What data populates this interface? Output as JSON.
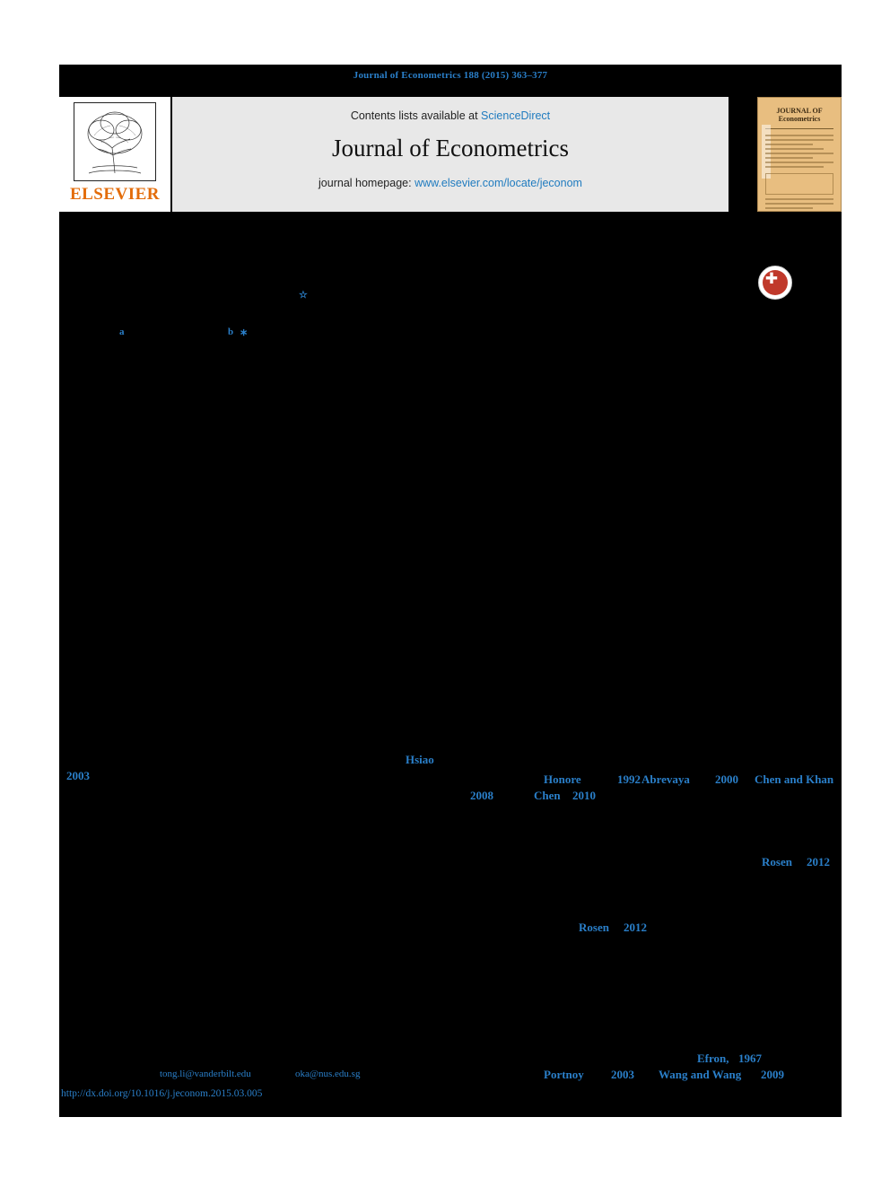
{
  "running_head": "Journal of Econometrics 188 (2015) 363–377",
  "masthead": {
    "publisher_name": "ELSEVIER",
    "contents_prefix": "Contents lists available at",
    "contents_link": "ScienceDirect",
    "journal_title": "Journal of Econometrics",
    "homepage_prefix": "journal homepage:",
    "homepage_link": "www.elsevier.com/locate/jeconom",
    "cover_title": "JOURNAL OF Econometrics"
  },
  "crossmark": {
    "label": "CrossMark",
    "glyph": "✚",
    "color": "#c0392b"
  },
  "title_marks": {
    "footnote_star": "☆",
    "affil_a": "a",
    "affil_b": "b",
    "corresponding_star": "∗"
  },
  "citations": [
    {
      "text": "Hsiao"
    },
    {
      "text": "2003"
    },
    {
      "text": "Honore"
    },
    {
      "text": "1992"
    },
    {
      "text": "Abrevaya"
    },
    {
      "text": "2000"
    },
    {
      "text": "Chen and Khan"
    },
    {
      "text": "2008"
    },
    {
      "text": "Chen"
    },
    {
      "text": "2010"
    },
    {
      "text": "Rosen"
    },
    {
      "text": "2012"
    },
    {
      "text": "Rosen"
    },
    {
      "text": "2012"
    },
    {
      "text": "Efron,"
    },
    {
      "text": "1967"
    },
    {
      "text": "Portnoy"
    },
    {
      "text": "2003"
    },
    {
      "text": "Wang and Wang"
    },
    {
      "text": "2009"
    }
  ],
  "emails": [
    {
      "address": "tong.li@vanderbilt.edu"
    },
    {
      "address": "oka@nus.edu.sg"
    }
  ],
  "doi": "http://dx.doi.org/10.1016/j.jeconom.2015.03.005"
}
